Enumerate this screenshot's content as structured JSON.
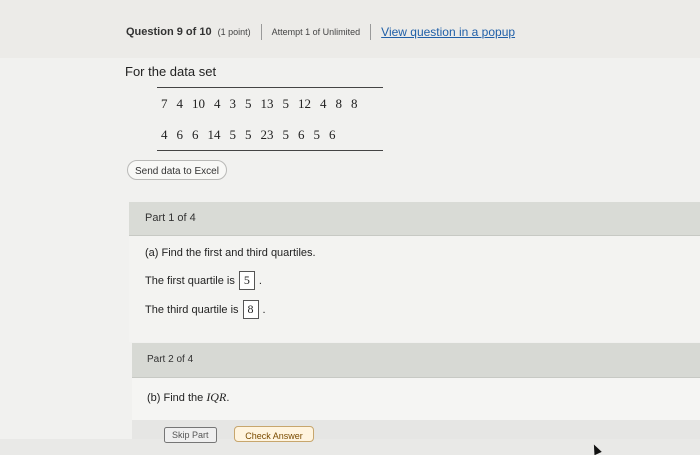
{
  "header": {
    "question_label": "Question 9 of 10",
    "points_label": "(1 point)",
    "attempt_label": "Attempt 1 of Unlimited",
    "popup_link_label": "View question in a popup"
  },
  "prompt": {
    "lead_text": "For the data set",
    "rows": [
      [
        "7",
        "4",
        "10",
        "4",
        "3",
        "5",
        "13",
        "5",
        "12",
        "4",
        "8",
        "8"
      ],
      [
        "4",
        "6",
        "6",
        "14",
        "5",
        "5",
        "23",
        "5",
        "6",
        "5",
        "6"
      ]
    ],
    "send_excel_label": "Send data to Excel"
  },
  "part1": {
    "header": "Part 1 of 4",
    "question": "(a) Find the first and third quartiles.",
    "first_quartile_label": "The first quartile is",
    "first_quartile_value": "5",
    "third_quartile_label": "The third quartile is",
    "third_quartile_value": "8"
  },
  "part2": {
    "header": "Part 2 of 4",
    "question_prefix": "(b) Find the",
    "question_iqr": "IQR",
    "question_suffix": "."
  },
  "actions": {
    "skip_label": "Skip Part",
    "check_label": "Check Answer"
  }
}
